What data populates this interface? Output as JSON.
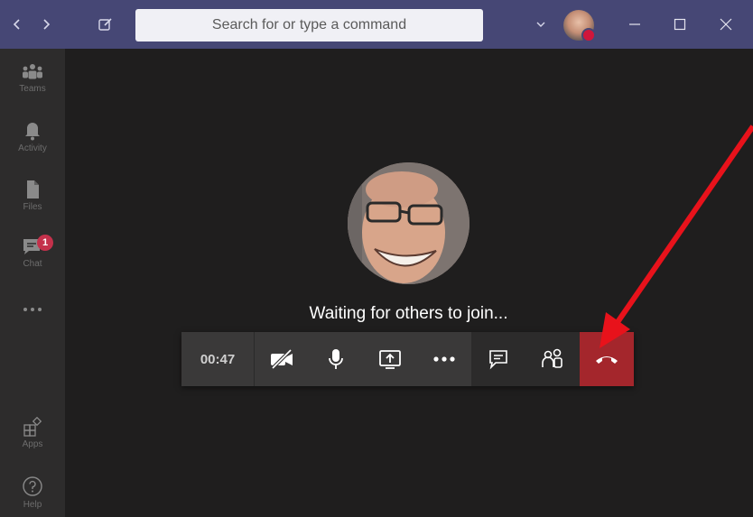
{
  "titlebar": {
    "search_placeholder": "Search for or type a command",
    "accent_color": "#464775"
  },
  "rail": {
    "items": [
      {
        "label": "Teams",
        "icon": "teams-icon"
      },
      {
        "label": "Activity",
        "icon": "bell-icon"
      },
      {
        "label": "Files",
        "icon": "file-icon"
      },
      {
        "label": "Chat",
        "icon": "chat-icon",
        "badge": "1"
      },
      {
        "label": "",
        "icon": "more-icon"
      },
      {
        "label": "Apps",
        "icon": "apps-icon"
      },
      {
        "label": "Help",
        "icon": "help-icon"
      }
    ]
  },
  "call": {
    "status_text": "Waiting for others to join...",
    "timer": "00:47",
    "controls": [
      "camera-off-icon",
      "microphone-icon",
      "share-screen-icon",
      "more-actions-icon",
      "chat-conversation-icon",
      "participants-icon",
      "hang-up-icon"
    ],
    "hangup_color": "#a4262c"
  },
  "annotation": {
    "arrow_color": "#e8121b"
  }
}
